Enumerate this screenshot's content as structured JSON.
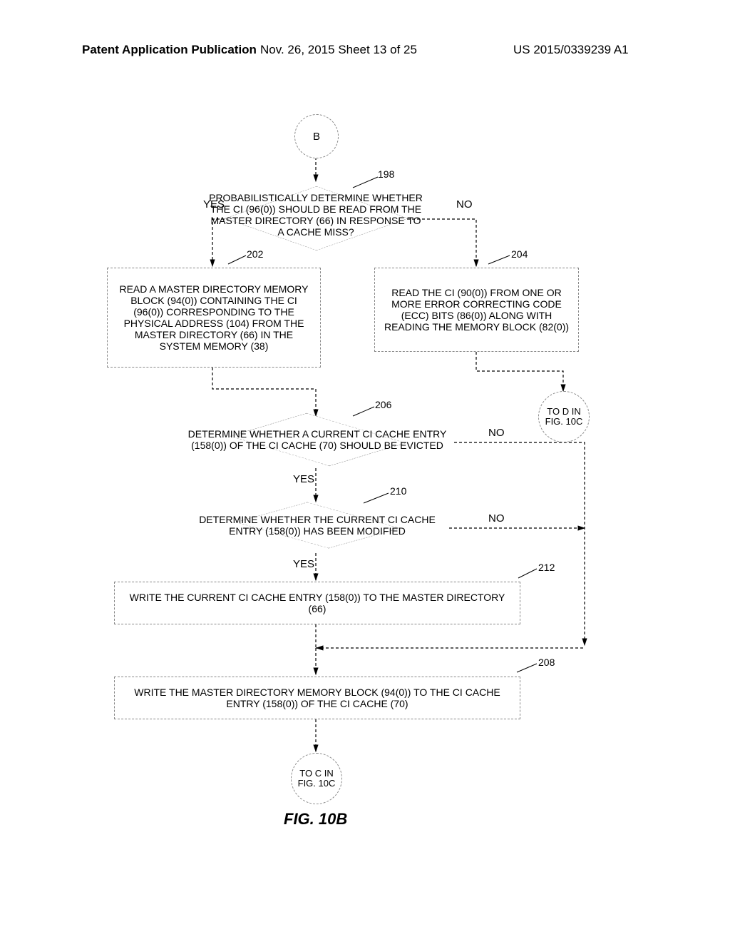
{
  "header": {
    "left": "Patent Application Publication",
    "mid": "Nov. 26, 2015  Sheet 13 of 25",
    "right": "US 2015/0339239 A1"
  },
  "connector_B": "B",
  "ref_198": "198",
  "decision_198": "PROBABILISTICALLY DETERMINE WHETHER THE CI (96(0)) SHOULD BE READ FROM THE MASTER DIRECTORY (66) IN RESPONSE TO A CACHE MISS?",
  "yes_198": "YES",
  "no_198": "NO",
  "ref_202": "202",
  "box_202": "READ A MASTER DIRECTORY MEMORY BLOCK (94(0)) CONTAINING THE CI (96(0)) CORRESPONDING TO THE PHYSICAL ADDRESS (104) FROM THE MASTER DIRECTORY (66) IN THE SYSTEM MEMORY (38)",
  "ref_204": "204",
  "box_204": "READ THE CI (90(0)) FROM ONE OR MORE ERROR CORRECTING CODE (ECC) BITS (86(0)) ALONG WITH READING THE MEMORY BLOCK (82(0))",
  "connector_D": "TO D IN FIG. 10C",
  "ref_206": "206",
  "decision_206": "DETERMINE WHETHER A CURRENT CI CACHE ENTRY (158(0)) OF THE CI CACHE (70) SHOULD BE EVICTED",
  "yes_206": "YES",
  "no_206": "NO",
  "ref_210": "210",
  "decision_210": "DETERMINE WHETHER THE CURRENT CI CACHE ENTRY (158(0)) HAS BEEN MODIFIED",
  "yes_210": "YES",
  "no_210": "NO",
  "ref_212": "212",
  "box_212": "WRITE THE CURRENT CI CACHE ENTRY (158(0)) TO THE MASTER DIRECTORY (66)",
  "ref_208": "208",
  "box_208": "WRITE THE MASTER DIRECTORY MEMORY BLOCK (94(0)) TO THE CI CACHE ENTRY (158(0)) OF THE CI CACHE (70)",
  "connector_C": "TO C IN FIG. 10C",
  "fig_caption": "FIG. 10B"
}
